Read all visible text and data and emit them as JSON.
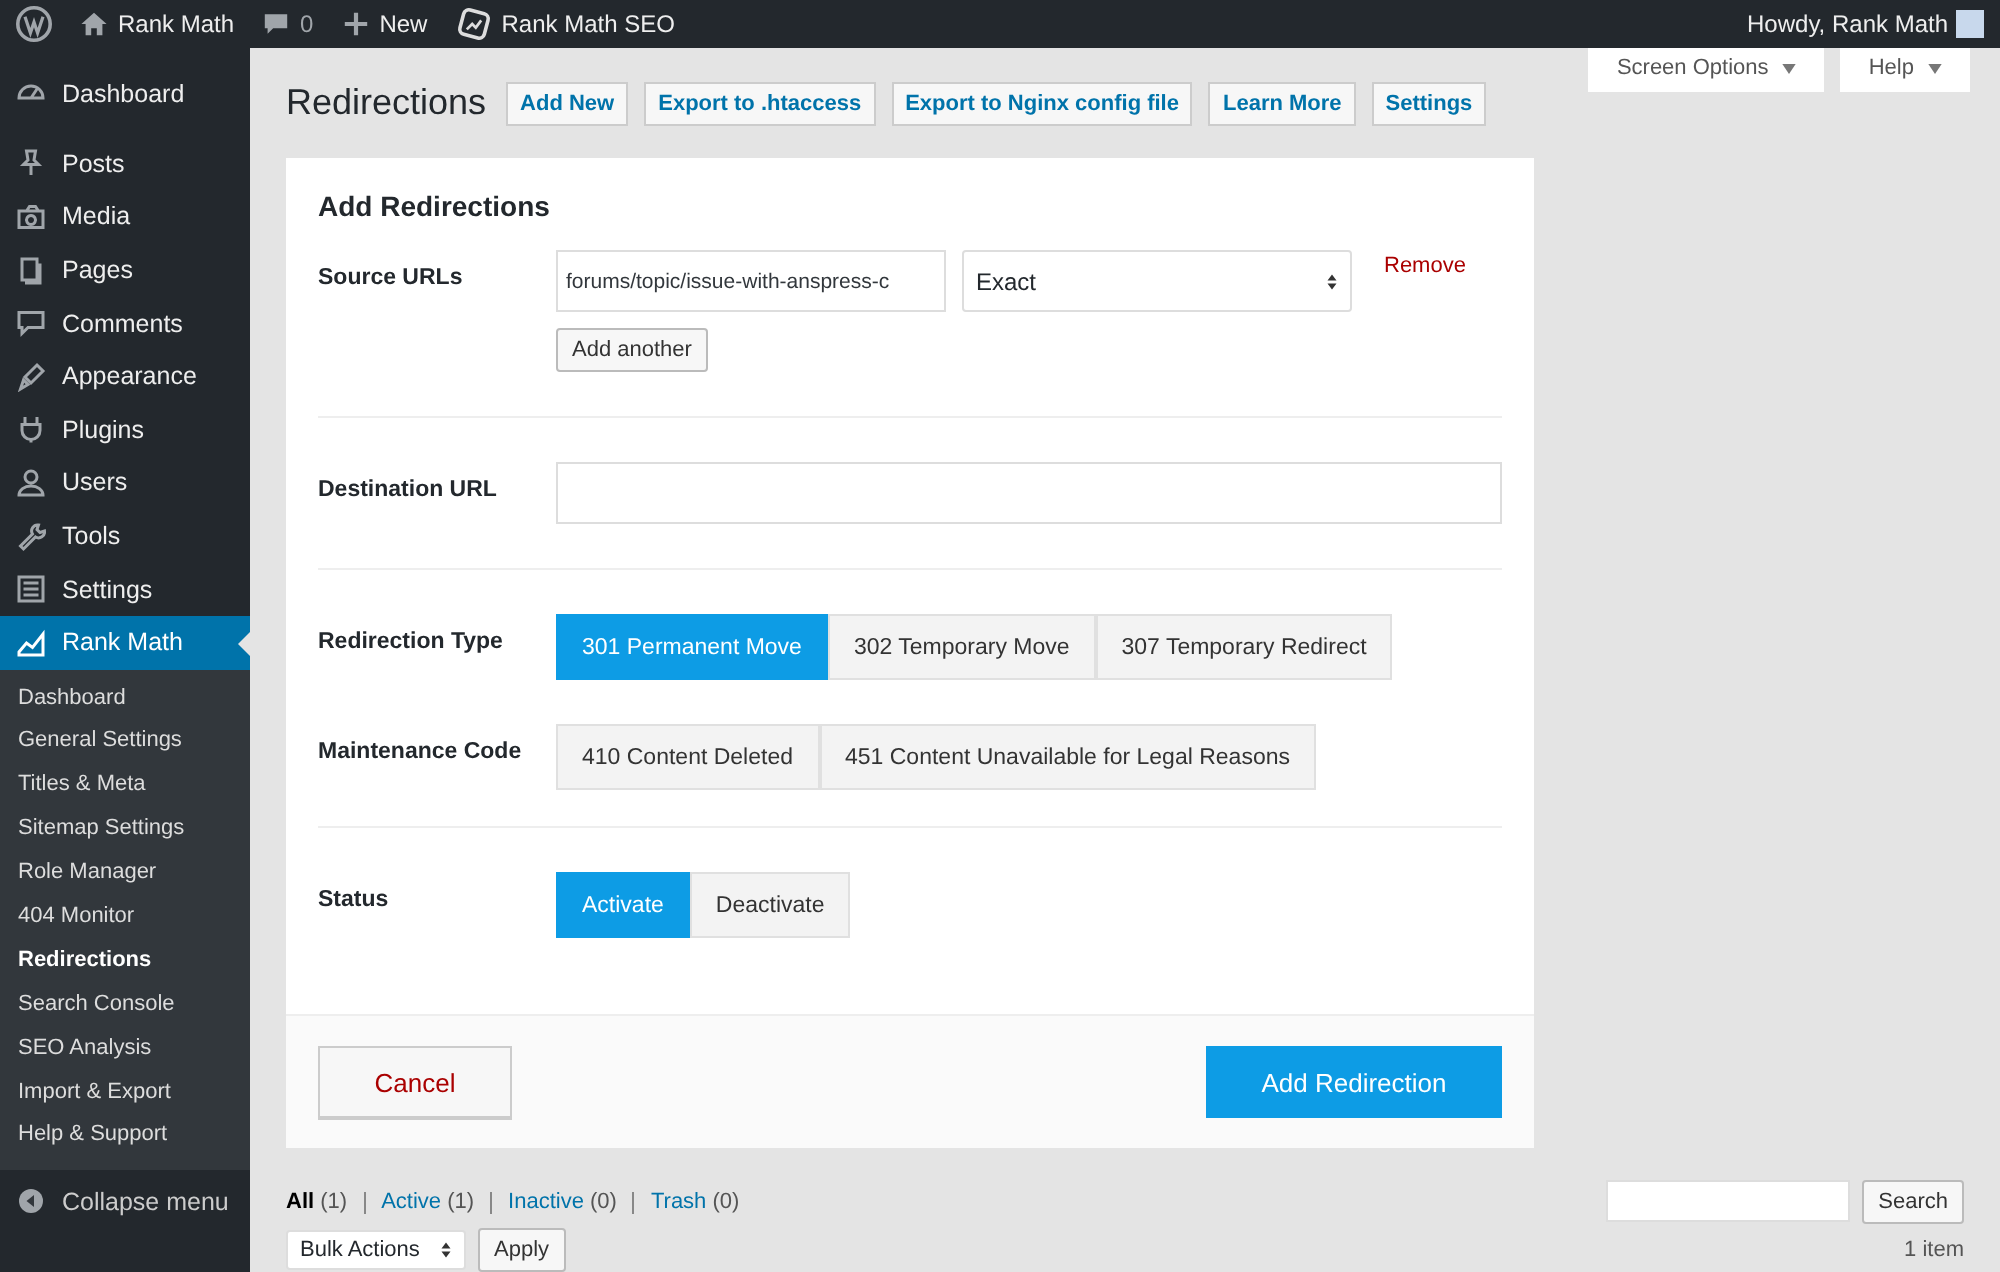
{
  "admin_bar": {
    "site": "Rank Math",
    "comments": "0",
    "new": "New",
    "plugin": "Rank Math SEO",
    "greeting": "Howdy, Rank Math"
  },
  "sidebar": {
    "items": [
      {
        "label": "Dashboard",
        "selected": false
      },
      {
        "label": "Posts",
        "selected": false
      },
      {
        "label": "Media",
        "selected": false
      },
      {
        "label": "Pages",
        "selected": false
      },
      {
        "label": "Comments",
        "selected": false
      },
      {
        "label": "Appearance",
        "selected": false
      },
      {
        "label": "Plugins",
        "selected": false
      },
      {
        "label": "Users",
        "selected": false
      },
      {
        "label": "Tools",
        "selected": false
      },
      {
        "label": "Settings",
        "selected": false
      },
      {
        "label": "Rank Math",
        "selected": true
      }
    ],
    "submenu": [
      {
        "label": "Dashboard",
        "selected": false
      },
      {
        "label": "General Settings",
        "selected": false
      },
      {
        "label": "Titles & Meta",
        "selected": false
      },
      {
        "label": "Sitemap Settings",
        "selected": false
      },
      {
        "label": "Role Manager",
        "selected": false
      },
      {
        "label": "404 Monitor",
        "selected": false
      },
      {
        "label": "Redirections",
        "selected": true
      },
      {
        "label": "Search Console",
        "selected": false
      },
      {
        "label": "SEO Analysis",
        "selected": false
      },
      {
        "label": "Import & Export",
        "selected": false
      },
      {
        "label": "Help & Support",
        "selected": false
      }
    ],
    "collapse": "Collapse menu"
  },
  "header": {
    "title": "Redirections",
    "actions": [
      "Add New",
      "Export to .htaccess",
      "Export to Nginx config file",
      "Learn More",
      "Settings"
    ],
    "screen_options": "Screen Options",
    "help": "Help"
  },
  "form": {
    "title": "Add Redirections",
    "source": {
      "label": "Source URLs",
      "value": "forums/topic/issue-with-anspress-c",
      "match": "Exact",
      "remove": "Remove",
      "add_another": "Add another"
    },
    "destination": {
      "label": "Destination URL"
    },
    "redirection_type": {
      "label": "Redirection Type",
      "options": [
        {
          "label": "301 Permanent Move",
          "selected": true
        },
        {
          "label": "302 Temporary Move",
          "selected": false
        },
        {
          "label": "307 Temporary Redirect",
          "selected": false
        }
      ]
    },
    "maintenance_code": {
      "label": "Maintenance Code",
      "options": [
        {
          "label": "410 Content Deleted",
          "selected": false
        },
        {
          "label": "451 Content Unavailable for Legal Reasons",
          "selected": false
        }
      ]
    },
    "status": {
      "label": "Status",
      "options": [
        {
          "label": "Activate",
          "selected": true
        },
        {
          "label": "Deactivate",
          "selected": false
        }
      ]
    },
    "cancel": "Cancel",
    "submit": "Add Redirection"
  },
  "list": {
    "views": [
      {
        "label": "All",
        "count": "(1)",
        "selected": true
      },
      {
        "label": "Active",
        "count": "(1)",
        "selected": false
      },
      {
        "label": "Inactive",
        "count": "(0)",
        "selected": false
      },
      {
        "label": "Trash",
        "count": "(0)",
        "selected": false
      }
    ],
    "search_button": "Search",
    "bulk_actions": "Bulk Actions",
    "apply": "Apply",
    "count": "1 item"
  }
}
